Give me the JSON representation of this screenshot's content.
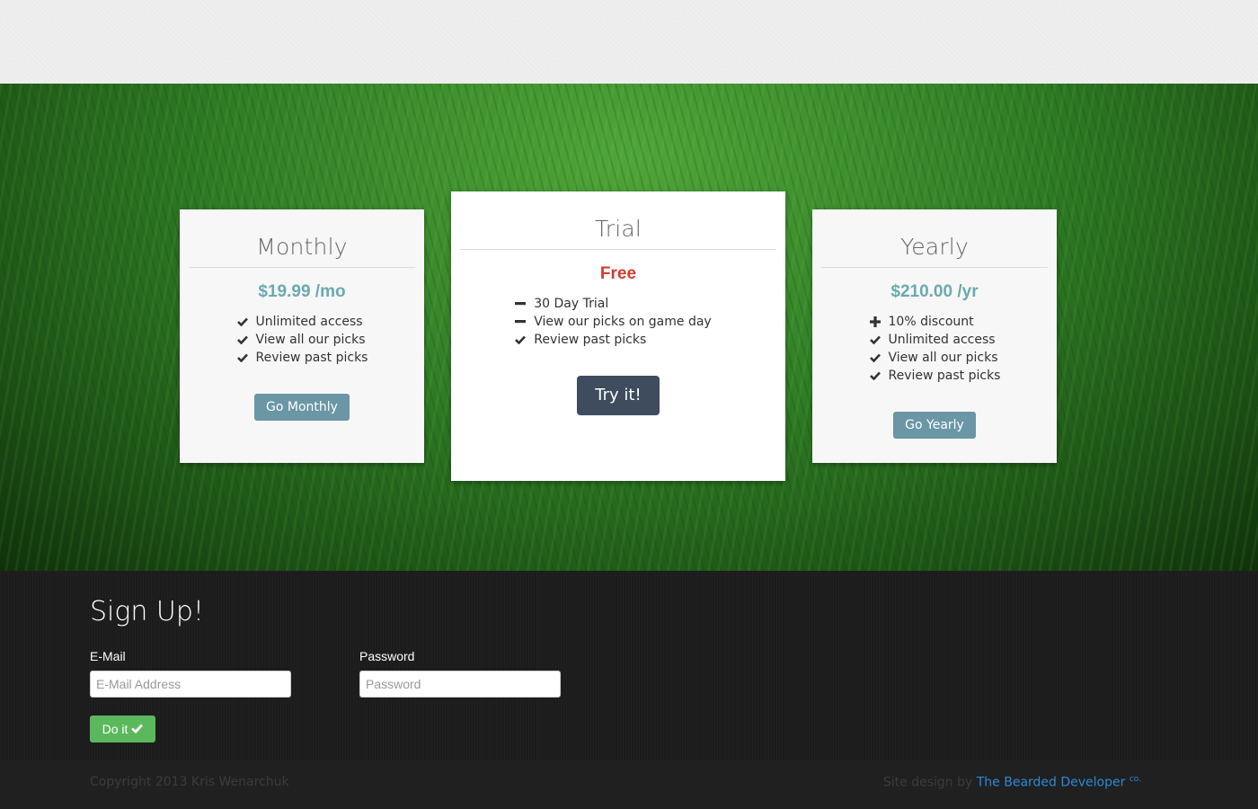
{
  "plans": {
    "monthly": {
      "title": "Monthly",
      "price": "$19.99 /mo",
      "features": [
        {
          "icon": "check",
          "text": "Unlimited access"
        },
        {
          "icon": "check",
          "text": "View all our picks"
        },
        {
          "icon": "check",
          "text": "Review past picks"
        }
      ],
      "button": "Go Monthly"
    },
    "trial": {
      "title": "Trial",
      "price": "Free",
      "features": [
        {
          "icon": "minus",
          "text": "30 Day Trial"
        },
        {
          "icon": "minus",
          "text": "View our picks on game day"
        },
        {
          "icon": "check",
          "text": "Review past picks"
        }
      ],
      "button": "Try it!"
    },
    "yearly": {
      "title": "Yearly",
      "price": "$210.00 /yr",
      "features": [
        {
          "icon": "plus",
          "text": "10% discount"
        },
        {
          "icon": "check",
          "text": "Unlimited access"
        },
        {
          "icon": "check",
          "text": "View all our picks"
        },
        {
          "icon": "check",
          "text": "Review past picks"
        }
      ],
      "button": "Go Yearly"
    }
  },
  "signup": {
    "heading": "Sign Up!",
    "email_label": "E-Mail",
    "email_placeholder": "E-Mail Address",
    "password_label": "Password",
    "password_placeholder": "Password",
    "submit_label": "Do it"
  },
  "footer": {
    "copyright": "Copyright 2013 Kris Wenarchuk",
    "credit_prefix": "Site design by ",
    "credit_link": "The Bearded Developer",
    "credit_suffix": "co."
  },
  "colors": {
    "price_accent": "#6aaab0",
    "free_red": "#d33a2c",
    "steel_button": "#6a96a6",
    "dark_button": "#3e4c5e",
    "success_green": "#5cb85c",
    "link_blue": "#2a8ad8"
  }
}
